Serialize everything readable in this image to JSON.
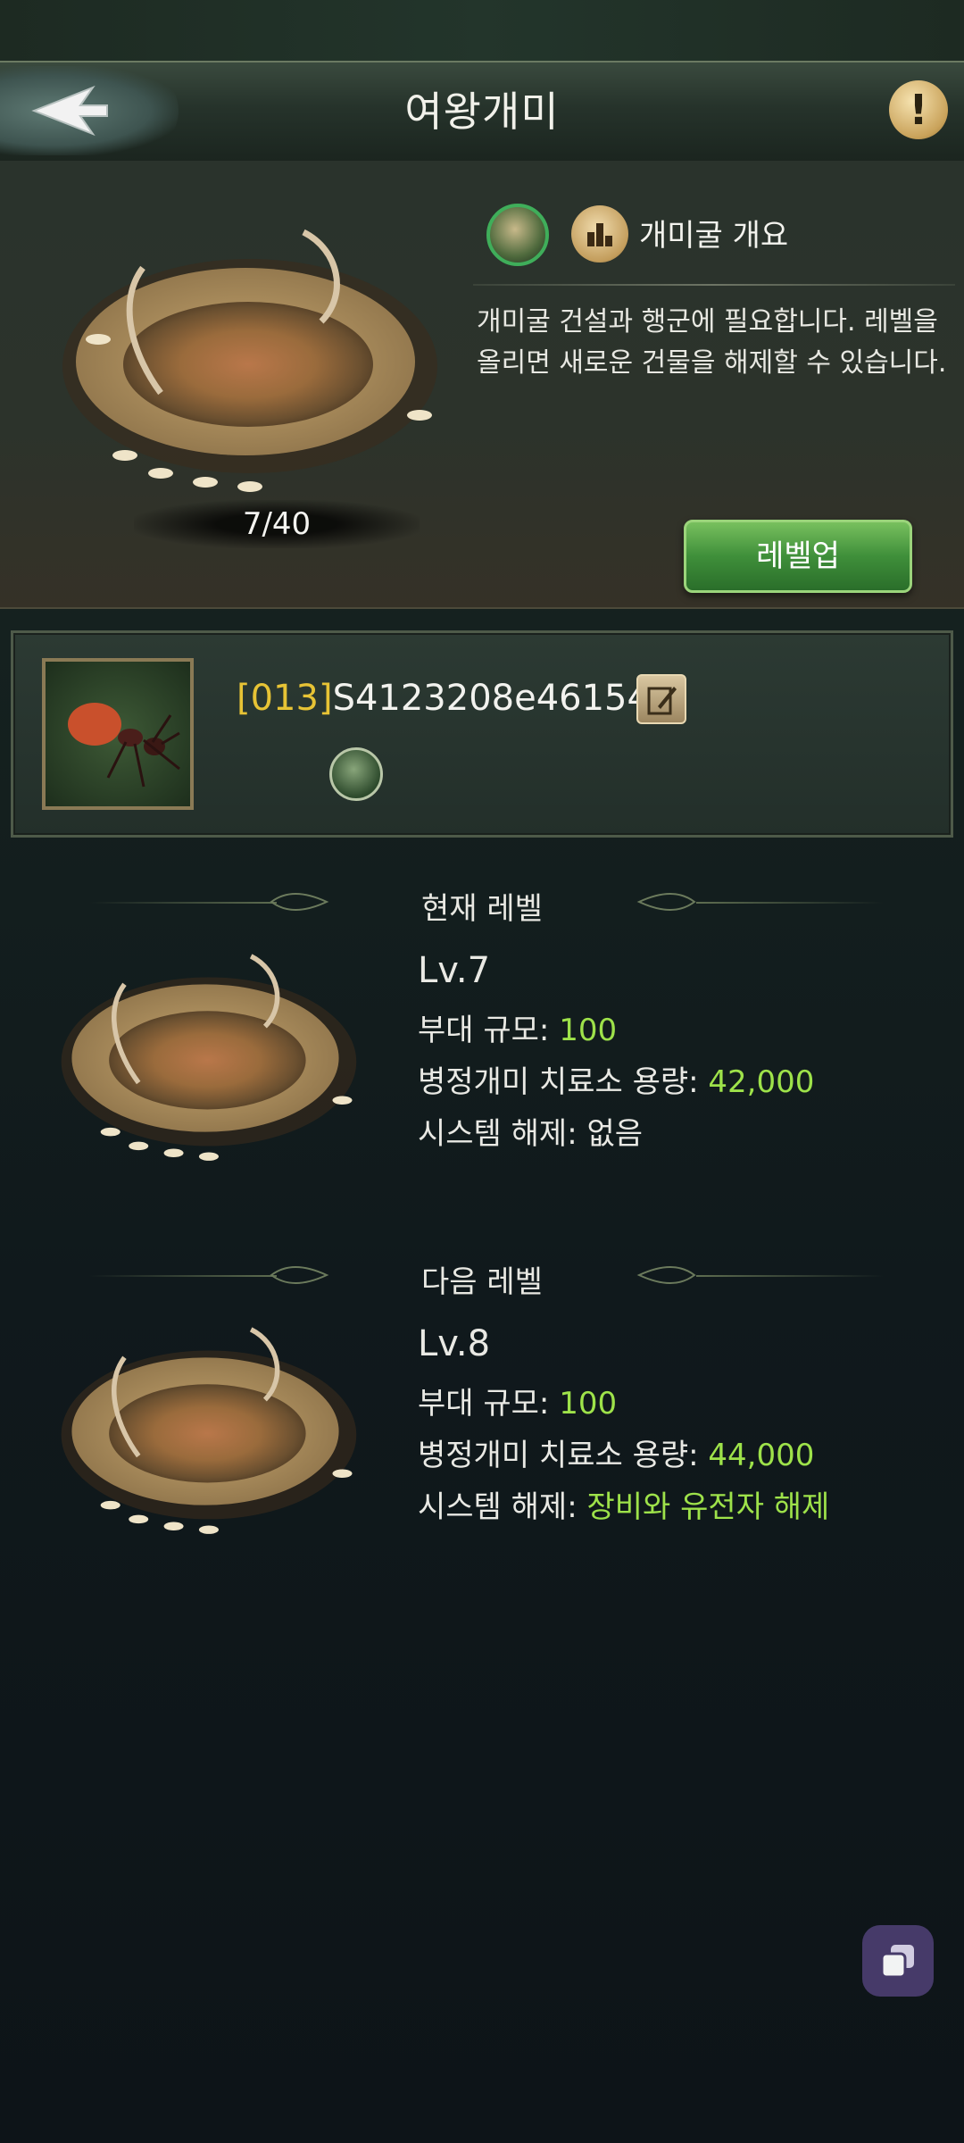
{
  "header": {
    "title": "여왕개미"
  },
  "overview": {
    "title": "개미굴 개요",
    "description": "개미굴 건설과 행군에 필요합니다. 레벨을 올리면 새로운 건물을 해제할 수 있습니다.",
    "level_count": "7/40",
    "levelup_label": "레벨업"
  },
  "owner": {
    "tag": "[013]",
    "name": "S4123208e46154"
  },
  "current_level": {
    "heading": "현재 레벨",
    "level": "Lv.7",
    "troop_label": "부대 규모: ",
    "troop_value": "100",
    "hospital_label": "병정개미 치료소 용량: ",
    "hospital_value": "42,000",
    "unlock_label": "시스템 해제: ",
    "unlock_value": "없음"
  },
  "next_level": {
    "heading": "다음 레벨",
    "level": "Lv.8",
    "troop_label": "부대 규모: ",
    "troop_value": "100",
    "hospital_label": "병정개미 치료소 용량: ",
    "hospital_value": "44,000",
    "unlock_label": "시스템 해제: ",
    "unlock_value": "장비와 유전자 해제"
  },
  "colors": {
    "value_green": "#9ee24a",
    "tag_yellow": "#e7c335",
    "button_green": "#3f8f3a",
    "floating_button": "#4a3d6e"
  },
  "icons": [
    "back-arrow-icon",
    "exclamation-icon",
    "nest-icon",
    "building-stats-icon",
    "edit-icon",
    "emblem-icon",
    "leaf-ornament-icon",
    "window-stack-icon"
  ]
}
